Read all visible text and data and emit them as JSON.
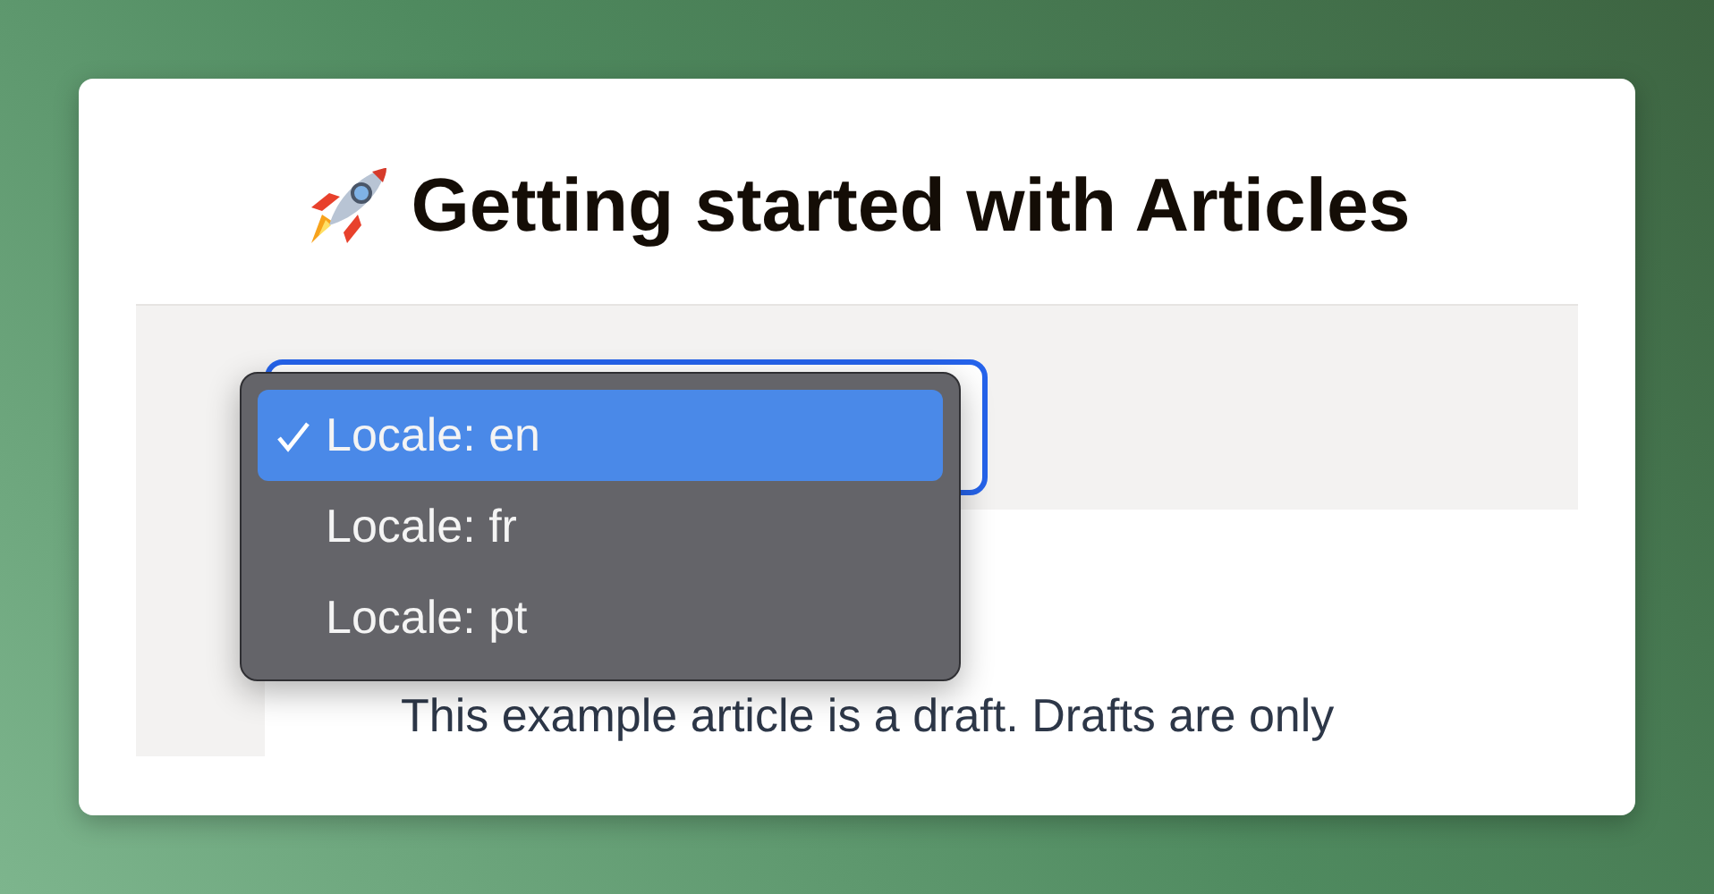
{
  "title": "Getting started with Articles",
  "locale_select": {
    "focused": true,
    "options": [
      {
        "label": "Locale: en",
        "selected": true
      },
      {
        "label": "Locale: fr",
        "selected": false
      },
      {
        "label": "Locale: pt",
        "selected": false
      }
    ]
  },
  "article": {
    "text": "This example article is a draft. Drafts are only"
  }
}
